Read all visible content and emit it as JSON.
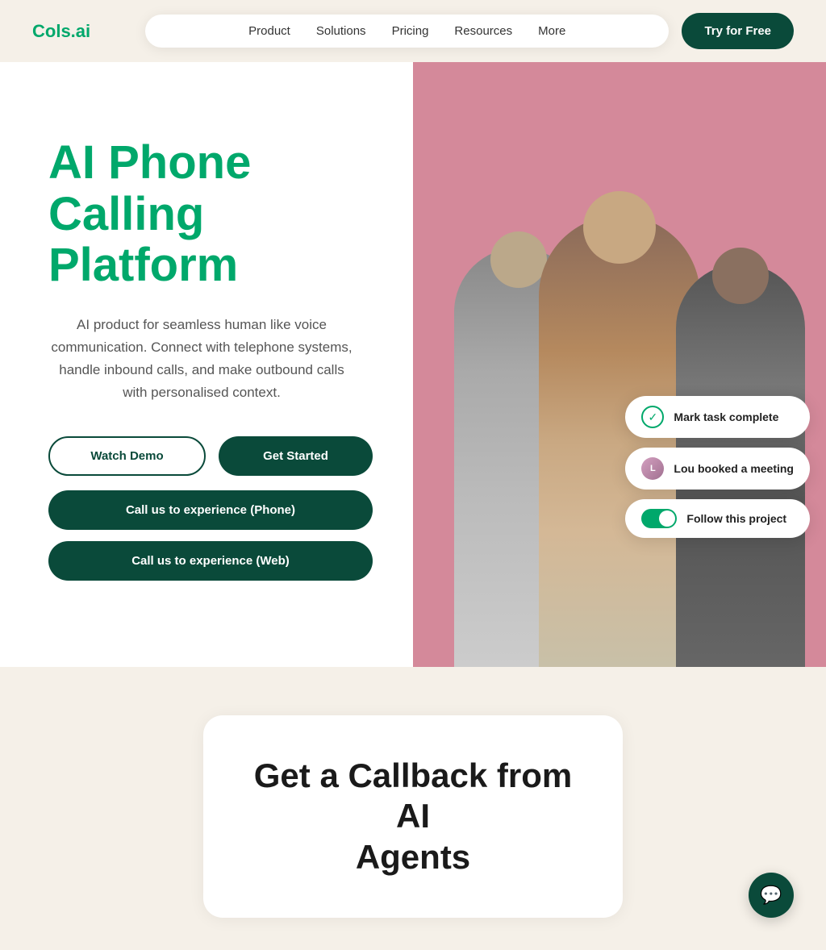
{
  "brand": {
    "logo": "Cols.ai"
  },
  "nav": {
    "links": [
      {
        "label": "Product",
        "id": "product"
      },
      {
        "label": "Solutions",
        "id": "solutions"
      },
      {
        "label": "Pricing",
        "id": "pricing"
      },
      {
        "label": "Resources",
        "id": "resources"
      },
      {
        "label": "More",
        "id": "more"
      }
    ],
    "cta_label": "Try for Free"
  },
  "hero": {
    "title_line1": "AI Phone Calling",
    "title_line2": "Platform",
    "description": "AI product for seamless human like voice communication. Connect with telephone systems, handle inbound calls, and make outbound calls with personalised context.",
    "btn_watch_demo": "Watch Demo",
    "btn_get_started": "Get Started",
    "btn_call_phone": "Call us to experience (Phone)",
    "btn_call_web": "Call us to experience (Web)"
  },
  "floating_cards": {
    "card1": {
      "label": "Mark task complete"
    },
    "card2": {
      "name": "Lou",
      "action": " booked a meeting"
    },
    "card3": {
      "label": "Follow this project"
    }
  },
  "bottom": {
    "callback_title_line1": "Get a Callback from AI",
    "callback_title_line2": "Agents"
  },
  "chat_fab": {
    "icon": "💬"
  }
}
